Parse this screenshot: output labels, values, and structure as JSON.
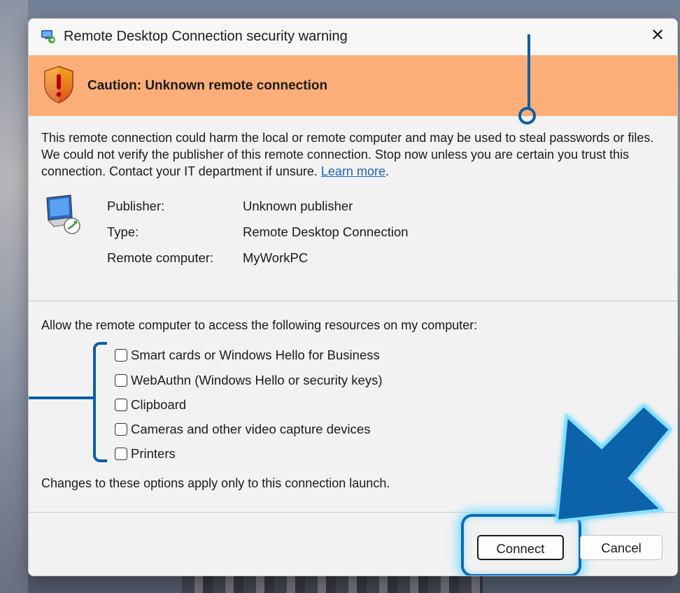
{
  "dialog": {
    "title": "Remote Desktop Connection security warning",
    "close_symbol": "✕"
  },
  "caution": {
    "text": "Caution: Unknown remote connection"
  },
  "warning": {
    "message": "This remote connection could harm the local or remote computer and may be used to steal passwords or files. We could not verify the publisher of this remote connection. Stop now unless you are certain you trust this connection. Contact your IT department if unsure.",
    "learn_more": "Learn more",
    "trailing": "."
  },
  "info": [
    {
      "label": "Publisher:",
      "value": "Unknown publisher"
    },
    {
      "label": "Type:",
      "value": "Remote Desktop Connection"
    },
    {
      "label": "Remote computer:",
      "value": "MyWorkPC"
    }
  ],
  "resources": {
    "heading": "Allow the remote computer to access the following resources on my computer:",
    "items": [
      {
        "label": "Smart cards or Windows Hello for Business",
        "checked": false
      },
      {
        "label": "WebAuthn (Windows Hello or security keys)",
        "checked": false
      },
      {
        "label": "Clipboard",
        "checked": false
      },
      {
        "label": "Cameras and other video capture devices",
        "checked": false
      },
      {
        "label": "Printers",
        "checked": false
      }
    ],
    "note": "Changes to these options apply only to this connection launch."
  },
  "buttons": {
    "connect": "Connect",
    "cancel": "Cancel"
  },
  "colors": {
    "caution_banner": "#fcae78",
    "annotation_blue": "#0d5ea6",
    "link": "#1f5fbf"
  },
  "icons": [
    "rdc-app-icon",
    "shield-warning-icon",
    "remote-computer-icon",
    "close-icon",
    "pointer-arrow-icon"
  ]
}
